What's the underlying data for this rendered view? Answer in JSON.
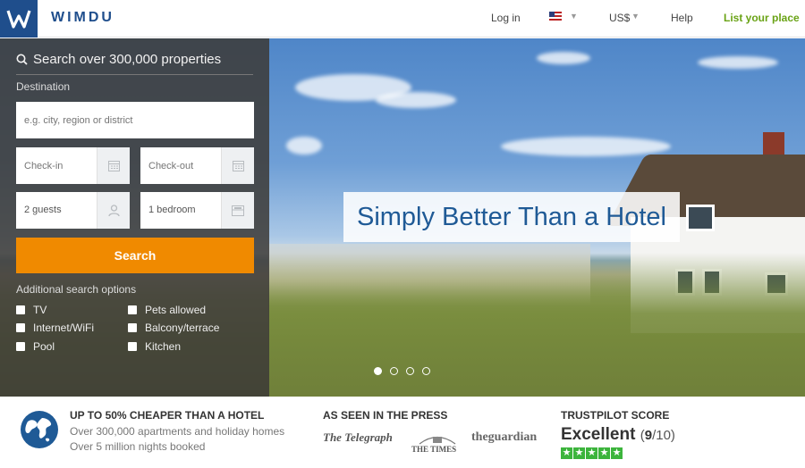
{
  "header": {
    "brand": "WIMDU",
    "login": "Log in",
    "currency": "US$",
    "help": "Help",
    "list_place": "List your place"
  },
  "hero": {
    "slogan": "Simply Better Than a Hotel",
    "slides": 4,
    "active_slide": 1
  },
  "search": {
    "title": "Search over 300,000 properties",
    "destination_label": "Destination",
    "destination_placeholder": "e.g. city, region or district",
    "checkin_placeholder": "Check-in",
    "checkout_placeholder": "Check-out",
    "guests_value": "2 guests",
    "bedrooms_value": "1 bedroom",
    "button_label": "Search",
    "additional_label": "Additional search options",
    "options": [
      "TV",
      "Pets allowed",
      "Internet/WiFi",
      "Balcony/terrace",
      "Pool",
      "Kitchen"
    ]
  },
  "benefits": {
    "title": "UP TO 50% CHEAPER THAN A HOTEL",
    "line1": "Over 300,000 apartments and holiday homes",
    "line2": "Over 5 million nights booked"
  },
  "press": {
    "title": "AS SEEN IN THE PRESS",
    "logos": [
      "The Telegraph",
      "THE TIMES",
      "theguardian"
    ]
  },
  "trustpilot": {
    "title": "TRUSTPILOT SCORE",
    "rating_word": "Excellent",
    "score_open": "(",
    "score": "9",
    "score_rest": "/10)",
    "stars": 5
  },
  "colors": {
    "brand_blue": "#1f4e8c",
    "accent_orange": "#f08a00",
    "list_green": "#6aa316",
    "trust_green": "#3cb43c"
  }
}
